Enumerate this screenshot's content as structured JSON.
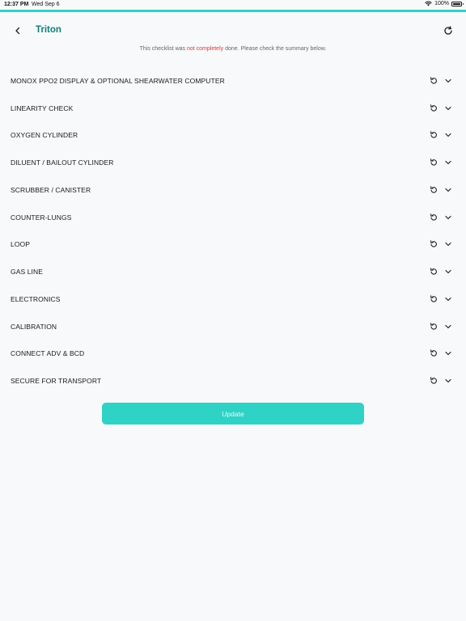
{
  "status_bar": {
    "time": "12:37 PM",
    "date": "Wed Sep 6",
    "battery": "100%"
  },
  "header": {
    "title": "Triton"
  },
  "notice": {
    "prefix": "This checklist was ",
    "highlight": "not completely",
    "suffix": " done. Please check the summary below."
  },
  "checklist": {
    "items": [
      {
        "label": "MONOX PPO2 DISPLAY & OPTIONAL SHEARWATER COMPUTER"
      },
      {
        "label": "LINEARITY CHECK"
      },
      {
        "label": "OXYGEN CYLINDER"
      },
      {
        "label": "DILUENT / BAILOUT CYLINDER"
      },
      {
        "label": "SCRUBBER / CANISTER"
      },
      {
        "label": "COUNTER-LUNGS"
      },
      {
        "label": "LOOP"
      },
      {
        "label": "GAS LINE"
      },
      {
        "label": "ELECTRONICS"
      },
      {
        "label": "CALIBRATION"
      },
      {
        "label": "CONNECT ADV & BCD"
      },
      {
        "label": "SECURE FOR TRANSPORT"
      }
    ]
  },
  "actions": {
    "update_label": "Update"
  },
  "colors": {
    "accent": "#2ed3c6",
    "title": "#0f8079",
    "warning": "#d63b3b"
  }
}
